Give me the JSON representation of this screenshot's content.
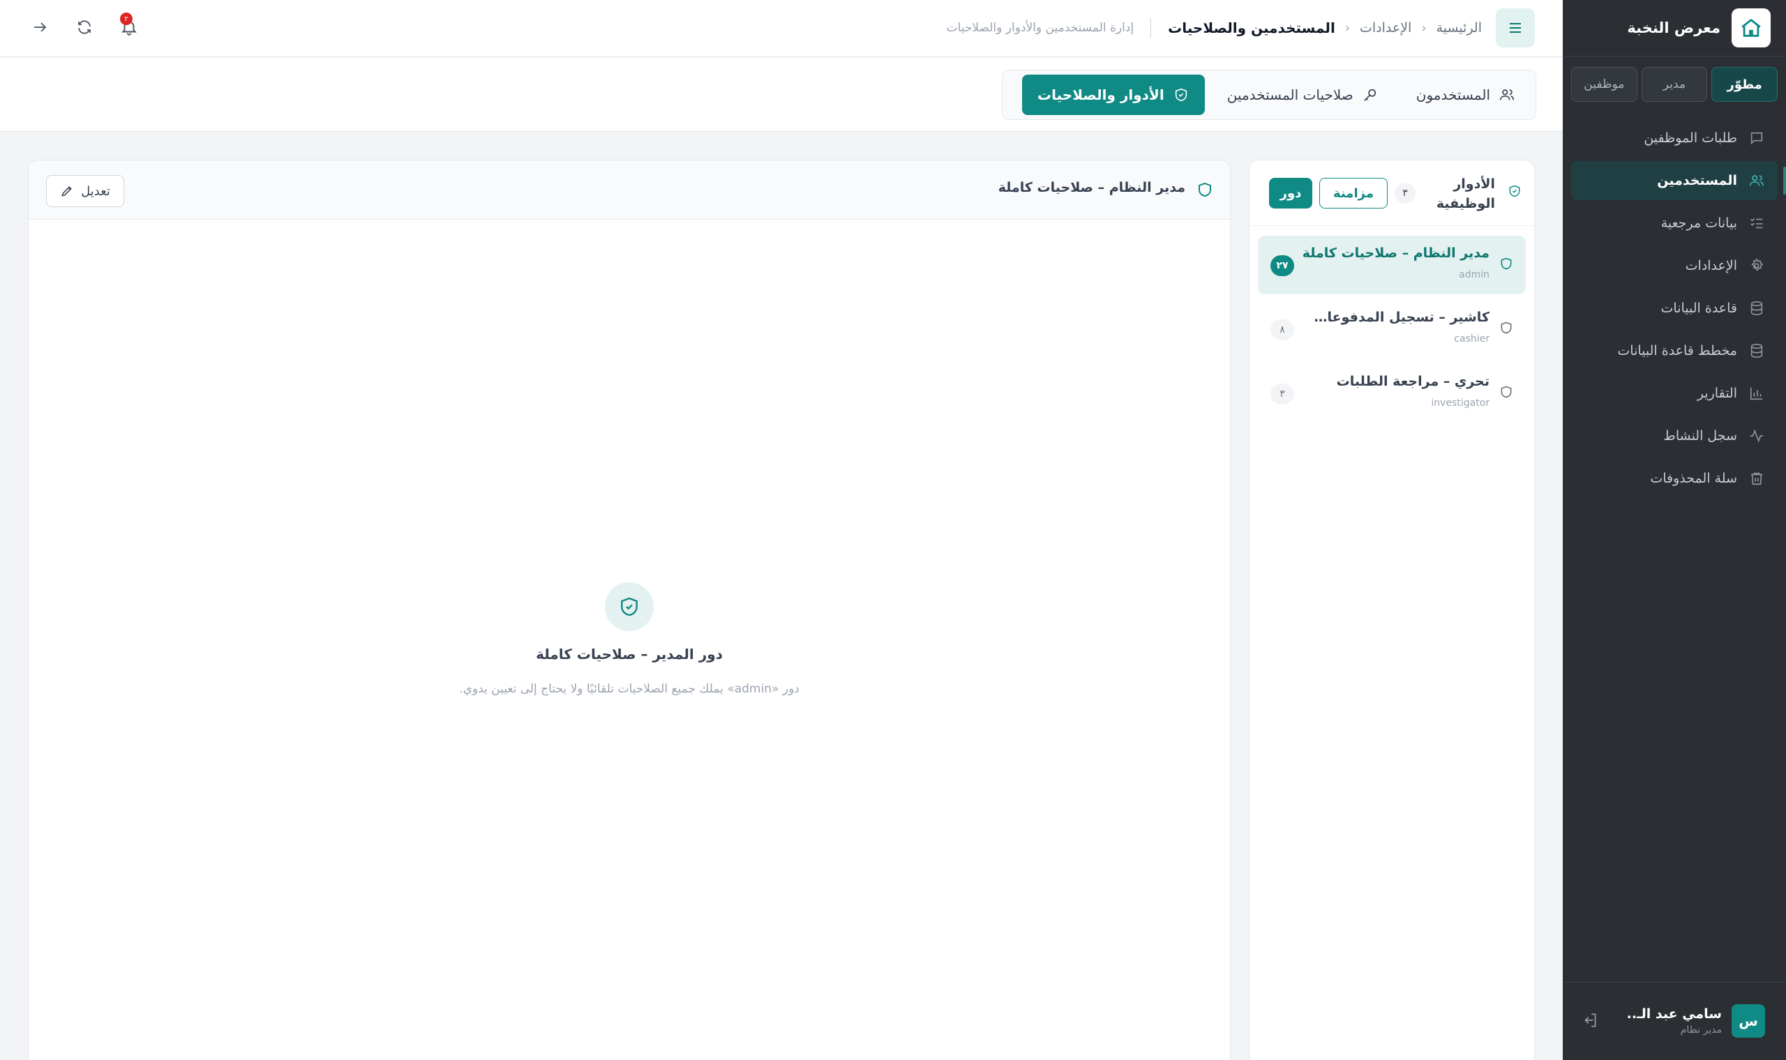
{
  "app": {
    "name": "معرض النخبة"
  },
  "sidebar": {
    "modes": [
      {
        "label": "مطوّر",
        "active": true
      },
      {
        "label": "مدير",
        "active": false
      },
      {
        "label": "موظفين",
        "active": false
      }
    ],
    "items": [
      {
        "label": "طلبات الموظفين",
        "icon": "message-square-icon"
      },
      {
        "label": "المستخدمين",
        "icon": "users-icon",
        "active": true
      },
      {
        "label": "بيانات مرجعية",
        "icon": "list-checks-icon"
      },
      {
        "label": "الإعدادات",
        "icon": "gear-icon"
      },
      {
        "label": "قاعدة البيانات",
        "icon": "database-icon"
      },
      {
        "label": "مخطط قاعدة البيانات",
        "icon": "database-schema-icon"
      },
      {
        "label": "التقارير",
        "icon": "bar-chart-icon"
      },
      {
        "label": "سجل النشاط",
        "icon": "activity-icon"
      },
      {
        "label": "سلة المحذوفات",
        "icon": "trash-icon"
      }
    ],
    "user": {
      "initial": "س",
      "name": "سامي عبد الـ..",
      "role": "مدير نظام"
    }
  },
  "topbar": {
    "breadcrumb": [
      "الرئيسية",
      "الإعدادات",
      "المستخدمين والصلاحيات"
    ],
    "description": "إدارة المستخدمين والأدوار والصلاحيات",
    "notifications_count": "٢"
  },
  "tabs": [
    {
      "label": "المستخدمون",
      "icon": "users-icon",
      "active": false
    },
    {
      "label": "صلاحيات المستخدمين",
      "icon": "key-icon",
      "active": false
    },
    {
      "label": "الأدوار والصلاحيات",
      "icon": "shield-check-icon",
      "active": true
    }
  ],
  "roles_panel": {
    "title": "الأدوار الوظيفية",
    "count": "٣",
    "sync_label": "مزامنة",
    "add_label": "دور",
    "roles": [
      {
        "name": "مدير النظام – صلاحيات كاملة",
        "key": "admin",
        "count": "٢٧",
        "active": true
      },
      {
        "name": "كاشير – تسجيل المدفوعات وا...",
        "key": "cashier",
        "count": "٨",
        "active": false
      },
      {
        "name": "تحري – مراجعة الطلبات",
        "key": "investigator",
        "count": "٣",
        "active": false
      }
    ]
  },
  "detail": {
    "title": "مدير النظام – صلاحيات كاملة",
    "edit_label": "تعديل",
    "empty_title": "دور المدير – صلاحيات كاملة",
    "empty_desc": "دور «admin» يملك جميع الصلاحيات تلقائيًا ولا يحتاج إلى تعيين يدوي."
  },
  "colors": {
    "accent": "#0f8a84",
    "sidebar_bg": "#2b2f33",
    "badge_red": "#dc2626"
  }
}
